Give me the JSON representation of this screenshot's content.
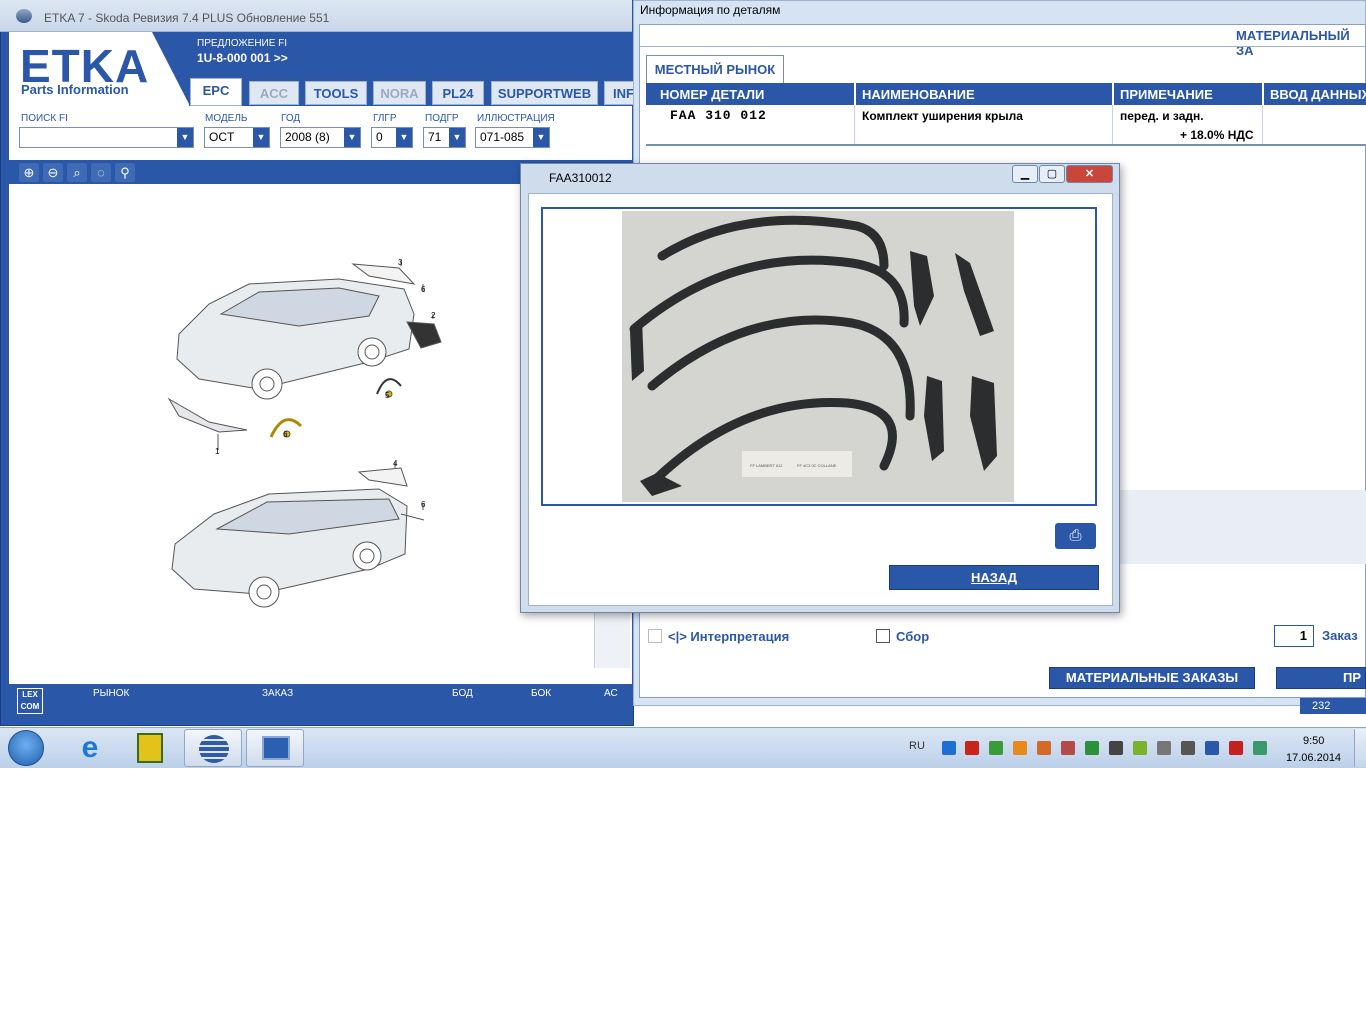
{
  "etka": {
    "title": "ETKA 7 - Skoda Ревизия 7.4 PLUS Обновление 551",
    "logo": "ETKA",
    "logo_sub": "Parts Information",
    "offer_label": "ПРЕДЛОЖЕНИЕ FI",
    "offer_value": "1U-8-000 001 >>",
    "tabs": [
      {
        "label": "EPC",
        "state": "active"
      },
      {
        "label": "ACC",
        "state": "dim"
      },
      {
        "label": "TOOLS",
        "state": "normal"
      },
      {
        "label": "NORA",
        "state": "dim"
      },
      {
        "label": "PL24",
        "state": "normal"
      },
      {
        "label": "SUPPORTWEB",
        "state": "normal"
      },
      {
        "label": "INF",
        "state": "normal"
      }
    ],
    "filters": {
      "search_label": "ПОИСК FI",
      "search_value": "",
      "model_label": "МОДЕЛЬ",
      "model_value": "OCT",
      "year_label": "ГОД",
      "year_value": "2008 (8)",
      "mg_label": "ГЛГР",
      "mg_value": "0",
      "sg_label": "ПОДГР",
      "sg_value": "71",
      "ill_label": "ИЛЛЮСТРАЦИЯ",
      "ill_value": "071-085"
    },
    "zoom_icons": [
      "zoom-in-icon",
      "zoom-out-icon",
      "zoom-fit-icon",
      "zoom-original-icon",
      "search-icon"
    ],
    "callouts": [
      "1",
      "2",
      "3",
      "4",
      "5",
      "6",
      "6",
      "6"
    ],
    "status": {
      "market": "РЫНОК",
      "order": "ЗАКАЗ",
      "bod": "БОД",
      "bok": "БОК",
      "ac": "АС",
      "lexcom": "LEX COM"
    }
  },
  "info": {
    "title": "Информация по деталям",
    "header_right": "МАТЕРИАЛЬНЫЙ ЗА",
    "tab": "МЕСТНЫЙ РЫНОК",
    "columns": [
      "НОМЕР ДЕТАЛИ",
      "НАИМЕНОВАНИЕ",
      "ПРИМЕЧАНИЕ",
      "ВВОД ДАННЫХ"
    ],
    "row": {
      "part_no": "FAA 310 012",
      "name": "Комплект уширения крыла",
      "note": "перед. и задн.",
      "vat": "+ 18.0% НДС"
    },
    "interpretation_label": "<|> Интерпретация",
    "collect_label": "Сбор",
    "qty": "1",
    "order_label": "Заказ",
    "material_orders_btn": "МАТЕРИАЛЬНЫЕ ЗАКАЗЫ",
    "right_btn": "ПР",
    "bottom_num": "232"
  },
  "popup": {
    "title": "FAA310012",
    "back_btn": "НАЗАД",
    "print_icon": "printer-icon",
    "label_text_1": "FF LAMBERT 812",
    "label_text_2": "FF 4C3 0C COLLANE"
  },
  "taskbar": {
    "lang": "RU",
    "time": "9:50",
    "date": "17.06.2014",
    "buttons": [
      "start-orb",
      "internet-explorer",
      "network-app",
      "etka-app",
      "remote-desktop"
    ],
    "tray_icons": [
      "teamviewer-icon",
      "pdf-icon",
      "check-icon",
      "archive-icon",
      "volume-icon",
      "tool-icon",
      "refresh-icon",
      "usb-icon",
      "android-icon",
      "speaker-icon",
      "device-icon",
      "network-icon",
      "vk-icon",
      "antivirus-icon",
      "update-icon"
    ]
  },
  "colors": {
    "etka_blue": "#2a57a8",
    "window_bg": "#d6e3f2"
  }
}
